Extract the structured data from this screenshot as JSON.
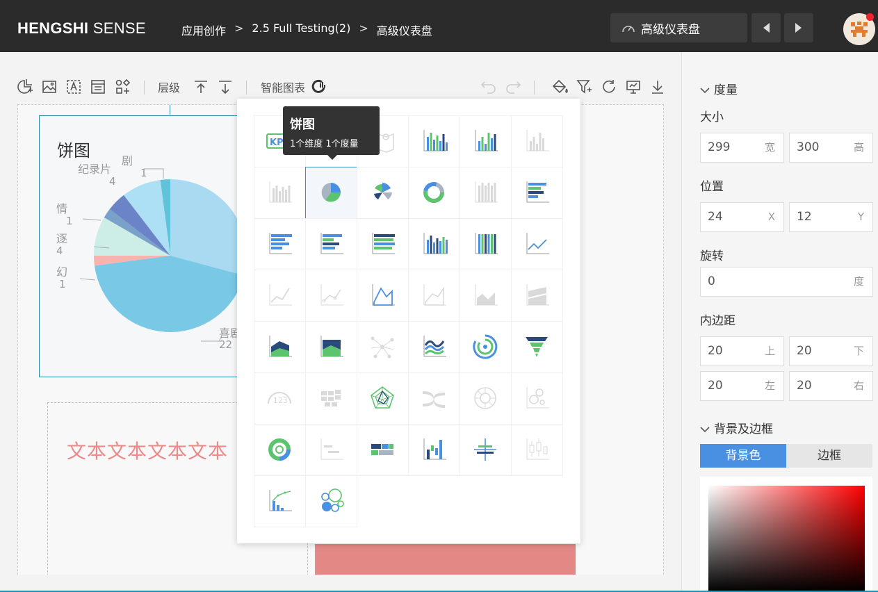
{
  "header": {
    "logo_bold": "HENGSHI",
    "logo_rest": "SENSE",
    "breadcrumb": [
      "应用创作",
      "2.5 Full Testing(2)",
      "高级仪表盘"
    ],
    "breadcrumb_sep": ">",
    "dashboard_name": "高级仪表盘"
  },
  "toolbar": {
    "layer_label": "层级",
    "smart_chart_label": "智能图表"
  },
  "pie_chart": {
    "title": "饼图",
    "labels": [
      {
        "name": "纪录片",
        "value": "4"
      },
      {
        "name": "剧",
        "value": "1"
      },
      {
        "name": "情",
        "value": "1"
      },
      {
        "name": "逐",
        "value": "4"
      },
      {
        "name": "幻",
        "value": "1"
      },
      {
        "name": "喜剧",
        "value": "22"
      }
    ]
  },
  "chart_data": {
    "type": "pie",
    "title": "饼图",
    "slices": [
      {
        "label": "纪录片",
        "value": 4
      },
      {
        "label": "剧",
        "value": 1
      },
      {
        "label": "情",
        "value": 1
      },
      {
        "label": "逐",
        "value": 4
      },
      {
        "label": "幻",
        "value": 1
      },
      {
        "label": "喜剧",
        "value": 22
      }
    ]
  },
  "text_card": {
    "text": "文本文本文本文本"
  },
  "picker": {
    "tooltip_title": "饼图",
    "tooltip_desc": "1个维度 1个度量",
    "kpi_label": "KPI",
    "gauge_label": "123"
  },
  "panel": {
    "measure_section": "度量",
    "size_label": "大小",
    "width": {
      "value": "299",
      "unit": "宽"
    },
    "height": {
      "value": "300",
      "unit": "高"
    },
    "position_label": "位置",
    "pos_x": {
      "value": "24",
      "unit": "X"
    },
    "pos_y": {
      "value": "12",
      "unit": "Y"
    },
    "rotate_label": "旋转",
    "rotate": {
      "value": "0",
      "unit": "度"
    },
    "padding_label": "内边距",
    "pad_top": {
      "value": "20",
      "unit": "上"
    },
    "pad_bottom": {
      "value": "20",
      "unit": "下"
    },
    "pad_left": {
      "value": "20",
      "unit": "左"
    },
    "pad_right": {
      "value": "20",
      "unit": "右"
    },
    "bg_section": "背景及边框",
    "tab_bg": "背景色",
    "tab_border": "边框"
  },
  "colors": {
    "accent": "#4a90e2",
    "green": "#5cc36e",
    "header_bg": "#2b2b2b",
    "selection": "#3b8fc4"
  }
}
